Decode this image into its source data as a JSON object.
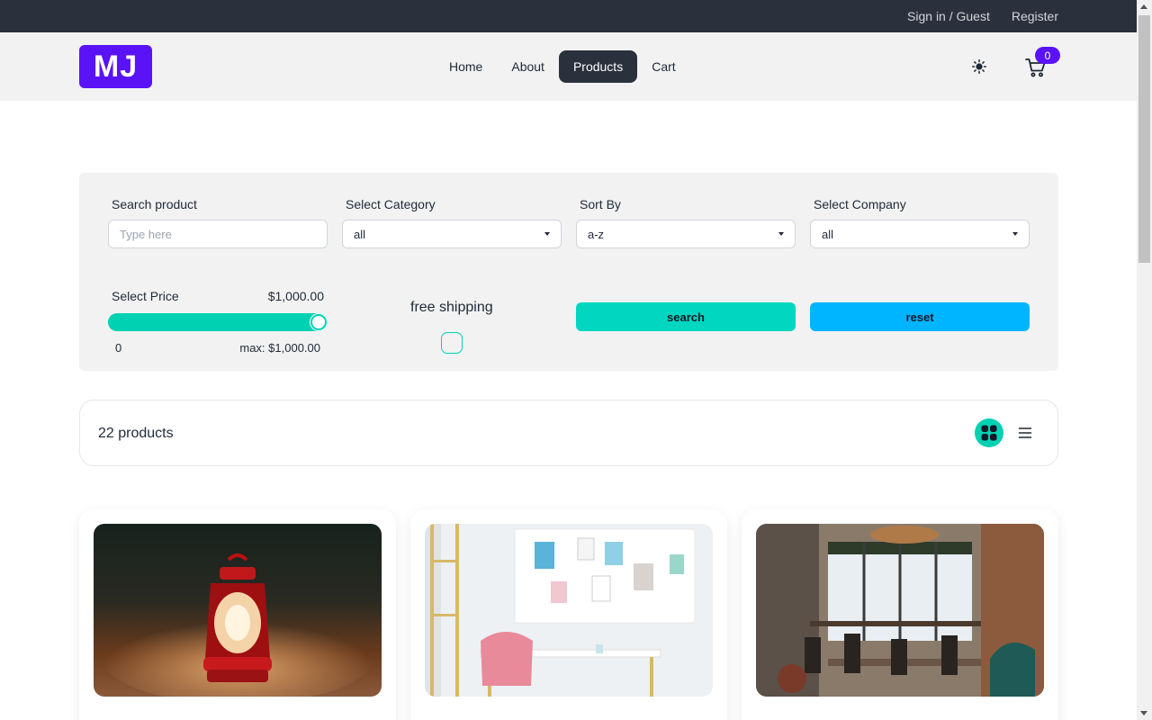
{
  "topbar": {
    "signin_label": "Sign in / Guest",
    "register_label": "Register"
  },
  "navbar": {
    "logo_text": "MJ",
    "links": [
      "Home",
      "About",
      "Products",
      "Cart"
    ],
    "active_link": "Products",
    "cart_count": "0"
  },
  "filters": {
    "search": {
      "label": "Search product",
      "placeholder": "Type here",
      "value": ""
    },
    "category": {
      "label": "Select Category",
      "value": "all"
    },
    "sort": {
      "label": "Sort By",
      "value": "a-z"
    },
    "company": {
      "label": "Select Company",
      "value": "all"
    },
    "price": {
      "label": "Select Price",
      "value_display": "$1,000.00",
      "min_label": "0",
      "max_label": "max: $1,000.00",
      "fill_fraction": 1.0
    },
    "shipping": {
      "label": "free shipping",
      "checked": false
    },
    "search_button": "search",
    "reset_button": "reset"
  },
  "products_header": {
    "count_label": "22 products",
    "view_mode": "grid"
  },
  "products": [
    {
      "image": "red-lantern-on-sand"
    },
    {
      "image": "white-desk-workspace"
    },
    {
      "image": "cafe-interior"
    }
  ],
  "colors": {
    "brand": "#5a13f6",
    "dark": "#2a303c",
    "accent": "#00d1b2",
    "info": "#00b5ff"
  }
}
